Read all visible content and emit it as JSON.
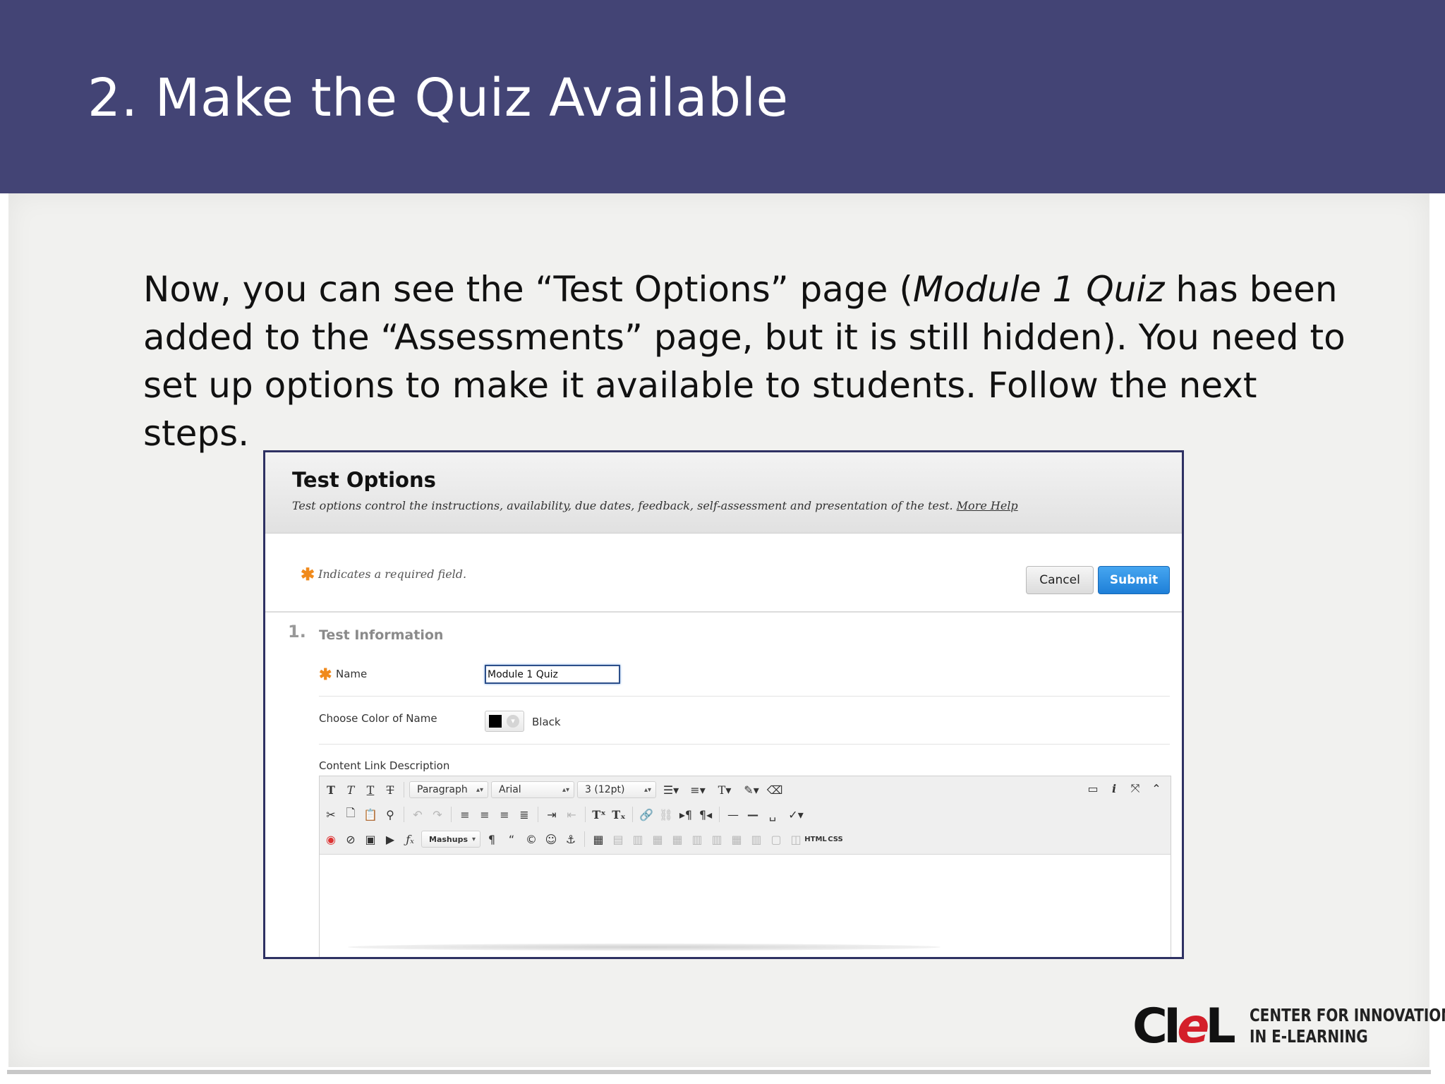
{
  "slide": {
    "title": "2. Make the Quiz Available",
    "instruction": {
      "part1": "Now, you can see the “Test Options” page (",
      "emphasis": "Module 1 Quiz",
      "part2": " has been added to the “Assessments” page, but it is still hidden). You need to set up options to make it available to students. Follow the next steps."
    }
  },
  "test_options": {
    "title": "Test Options",
    "description": "Test options control the instructions, availability, due dates, feedback, self-assessment and presentation of the test.",
    "help_link": "More Help",
    "required_star": "✱",
    "required_note": "Indicates a required field.",
    "cancel_label": "Cancel",
    "submit_label": "Submit",
    "section": {
      "number": "1.",
      "title": "Test Information"
    },
    "name_label": "Name",
    "name_value": "Module 1 Quiz",
    "color_label": "Choose Color of Name",
    "color_value": "Black",
    "swatch_color": "#000000",
    "content_label": "Content Link Description"
  },
  "editor_toolbar": {
    "format_select": "Paragraph",
    "font_select": "Arial",
    "size_select": "3 (12pt)",
    "mashups_label": "Mashups",
    "html_label": "HTML",
    "css_label": "CSS",
    "icons": [
      "bold-icon",
      "italic-icon",
      "underline-icon",
      "strikethrough-icon",
      "bullet-list-icon",
      "numbered-list-icon",
      "text-color-icon",
      "highlight-icon",
      "eraser-icon",
      "cut-icon",
      "copy-icon",
      "paste-icon",
      "find-icon",
      "undo-icon",
      "redo-icon",
      "align-left-icon",
      "align-center-icon",
      "align-right-icon",
      "justify-icon",
      "indent-icon",
      "outdent-icon",
      "superscript-icon",
      "subscript-icon",
      "link-icon",
      "unlink-icon",
      "ltr-icon",
      "rtl-icon",
      "hr-icon",
      "spellcheck-icon",
      "record-icon",
      "attach-icon",
      "image-icon",
      "media-icon",
      "formula-icon",
      "pilcrow-icon",
      "quote-icon",
      "copyright-icon",
      "emoji-icon",
      "anchor-icon",
      "table-icon",
      "preview-icon",
      "info-icon",
      "fullscreen-icon",
      "collapse-icon"
    ]
  },
  "logo": {
    "mark": "CIeL",
    "line1": "CENTER FOR INNOVATION",
    "line2": "IN E-LEARNING"
  }
}
